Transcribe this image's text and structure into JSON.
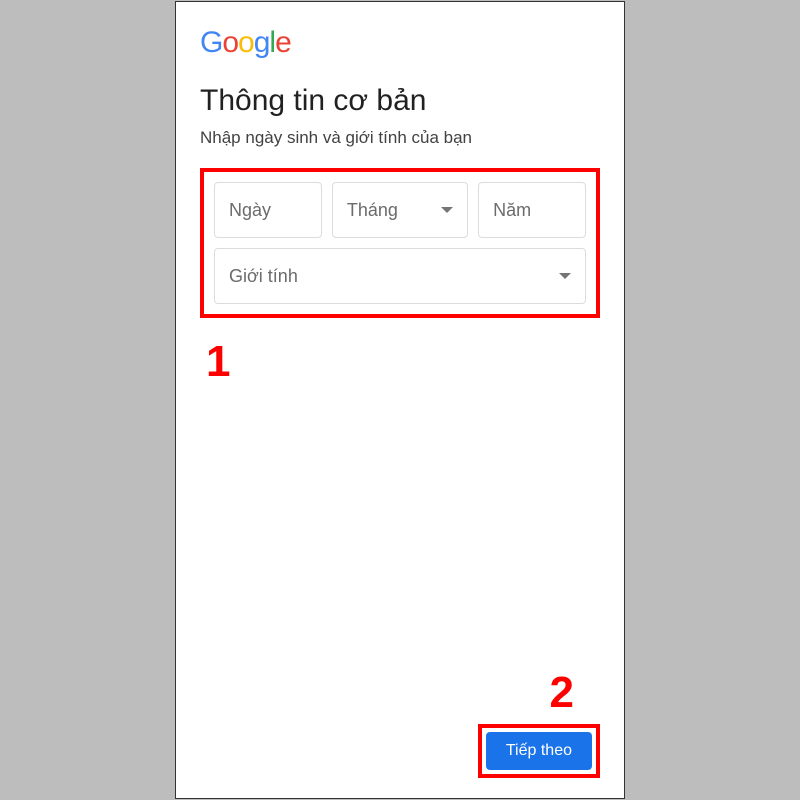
{
  "logo": {
    "g1": "G",
    "o1": "o",
    "o2": "o",
    "g2": "g",
    "l1": "l",
    "e1": "e"
  },
  "title": "Thông tin cơ bản",
  "subtitle": "Nhập ngày sinh và giới tính của bạn",
  "fields": {
    "day": "Ngày",
    "month": "Tháng",
    "year": "Năm",
    "gender": "Giới tính"
  },
  "callouts": {
    "one": "1",
    "two": "2"
  },
  "buttons": {
    "next": "Tiếp theo"
  }
}
